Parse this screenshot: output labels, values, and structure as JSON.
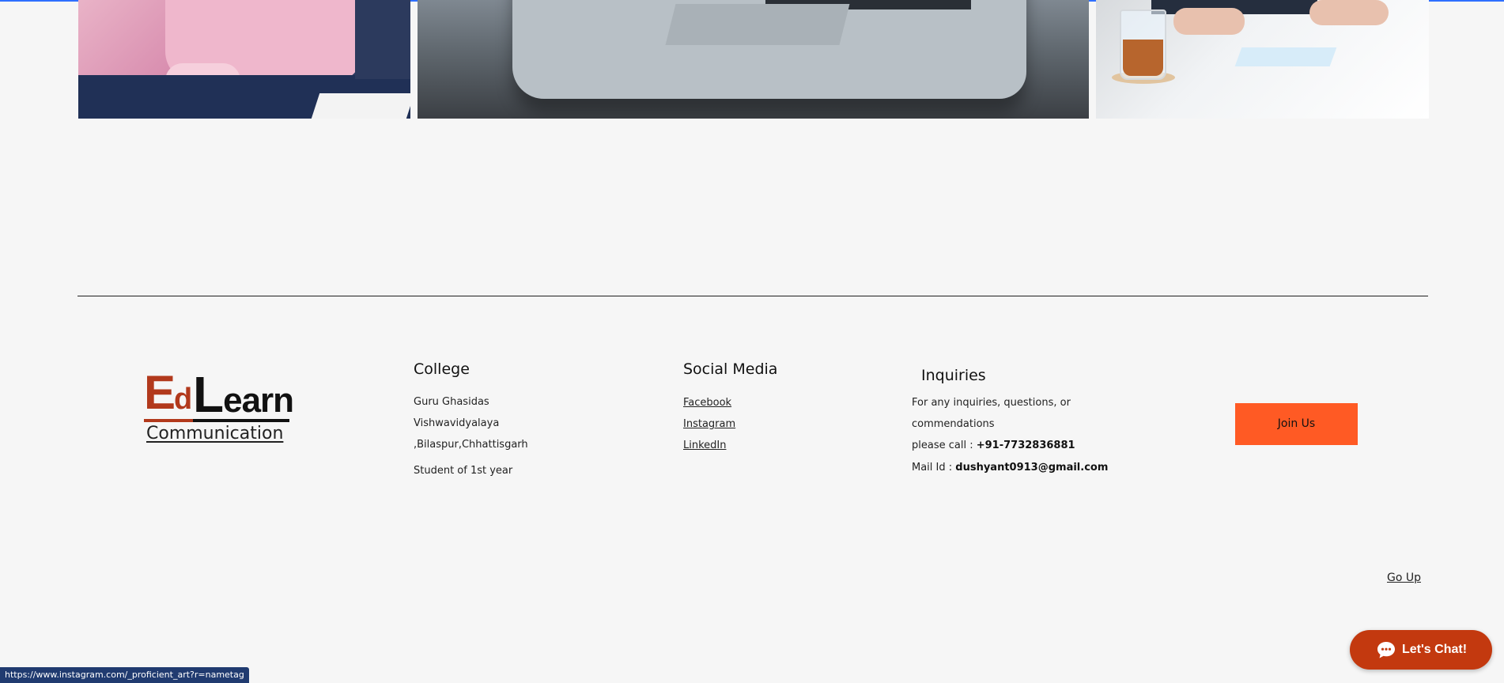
{
  "logo": {
    "ed_e": "E",
    "ed_d": "d",
    "learn_l": "L",
    "learn_rest": "earn",
    "subtitle": "Communication"
  },
  "college": {
    "heading": "College",
    "lines": [
      "Guru Ghasidas",
      "Vishwavidyalaya",
      ",Bilaspur,Chhattisgarh",
      "Student of 1st year"
    ]
  },
  "social": {
    "heading": "Social Media",
    "links": [
      "Facebook",
      "Instagram",
      "LinkedIn"
    ]
  },
  "inquiries": {
    "heading": "Inquiries",
    "line1": "For any inquiries, questions, or",
    "line2": "commendations",
    "call_prefix": "please call : ",
    "phone": "+91-7732836881",
    "mail_prefix": "Mail Id : ",
    "email": "dushyant0913@gmail.com"
  },
  "join_button": "Join Us",
  "go_up": "Go Up",
  "chat": {
    "label": "Let's Chat!"
  },
  "status_bar": {
    "url": "https://www.instagram.com/_proficient_art?r=nametag"
  },
  "colors": {
    "accent_orange": "#ff5a24",
    "logo_red": "#b2391c",
    "chat_red": "#c3390f",
    "status_blue": "#203b70"
  }
}
